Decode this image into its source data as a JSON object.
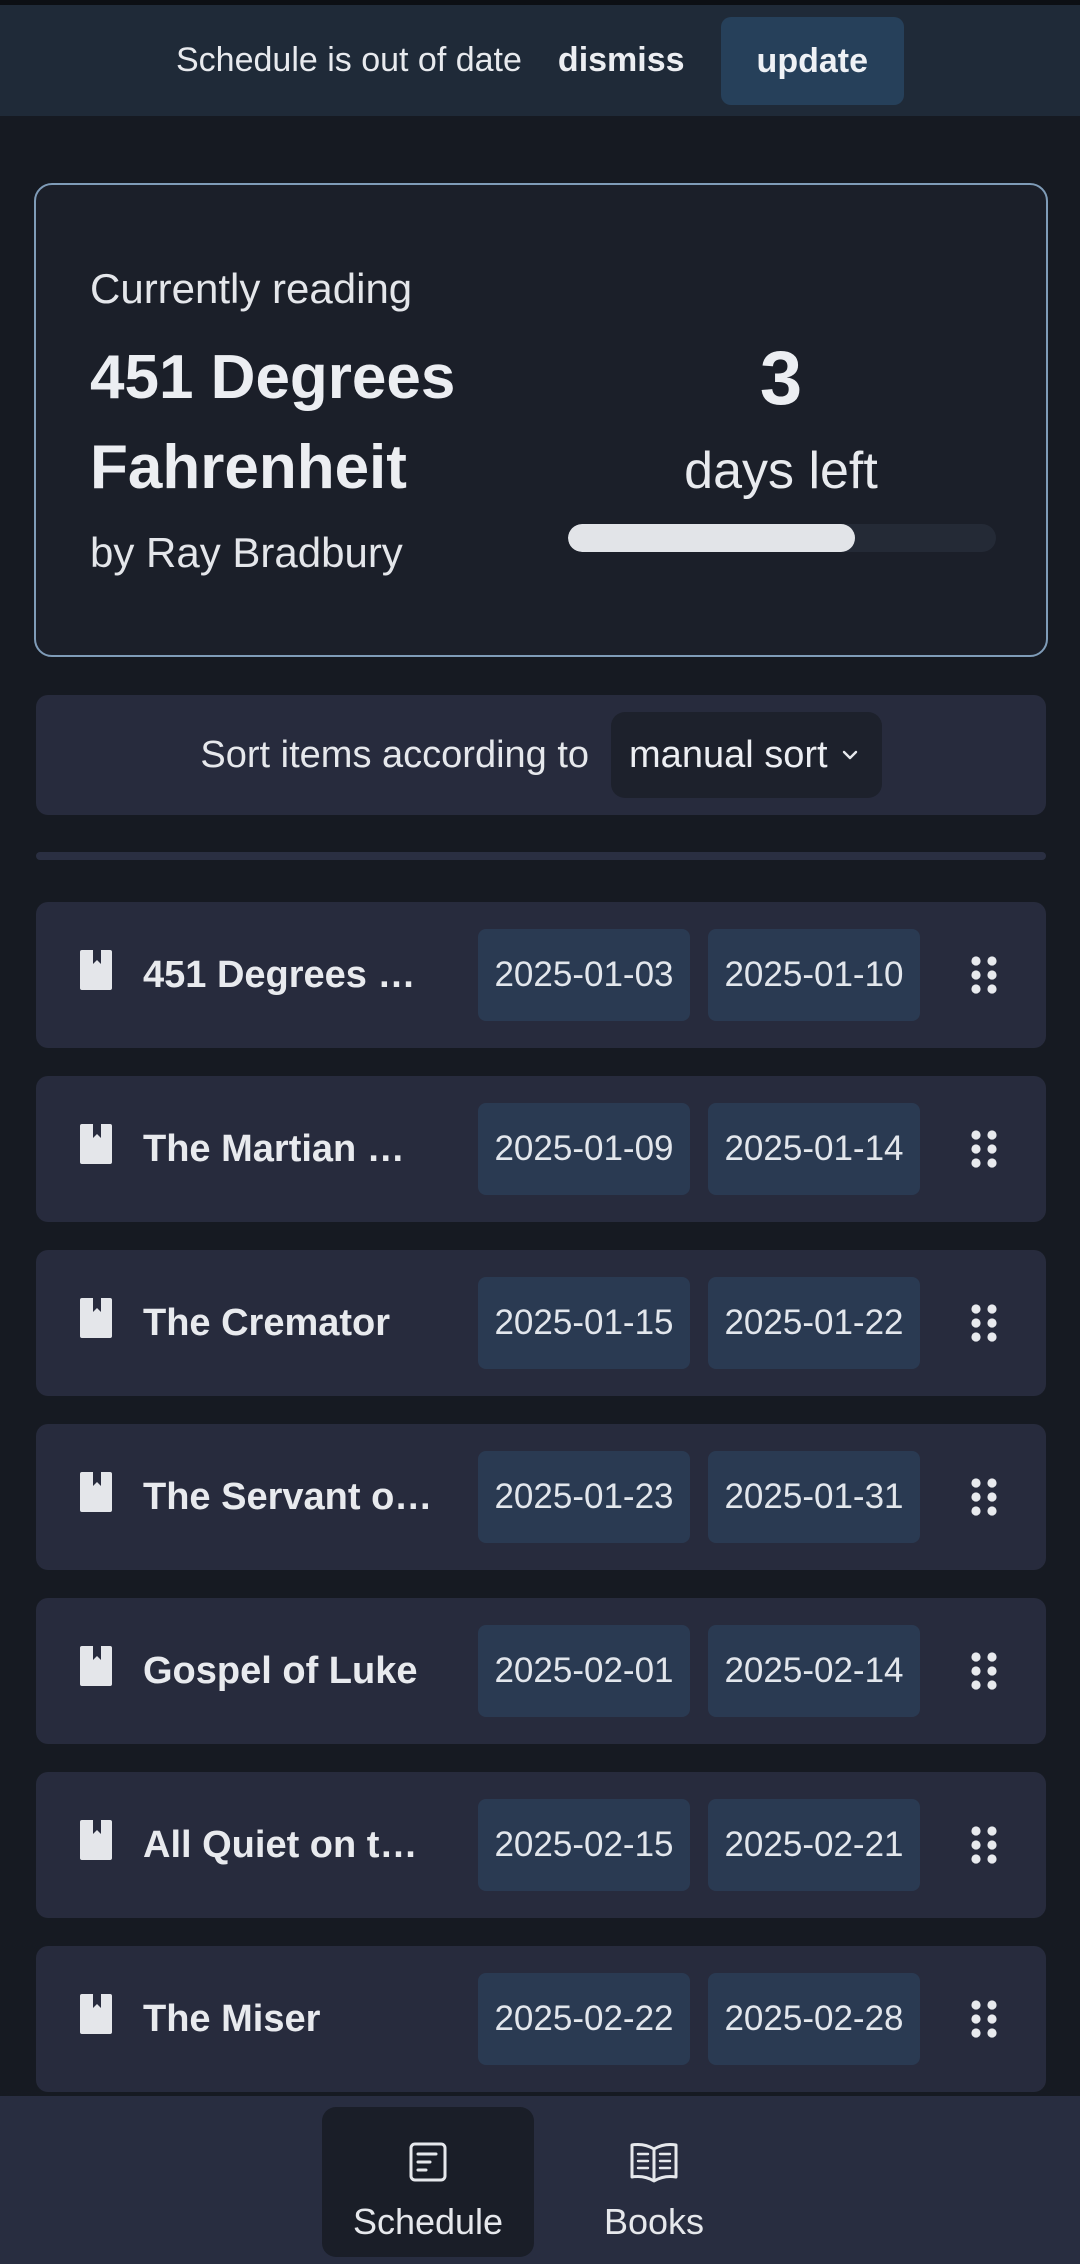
{
  "banner": {
    "message": "Schedule is out of date",
    "dismiss_label": "dismiss",
    "update_label": "update"
  },
  "current": {
    "label": "Currently reading",
    "title": "451 Degrees Fahrenheit",
    "author": "by Ray Bradbury",
    "days_left": "3",
    "days_left_label": "days left",
    "progress": 0.67
  },
  "sort": {
    "label": "Sort items according to",
    "selected": "manual sort"
  },
  "items": [
    {
      "title": "451 Degrees …",
      "start": "2025-01-03",
      "end": "2025-01-10"
    },
    {
      "title": "The Martian …",
      "start": "2025-01-09",
      "end": "2025-01-14"
    },
    {
      "title": "The Cremator",
      "start": "2025-01-15",
      "end": "2025-01-22"
    },
    {
      "title": "The Servant o…",
      "start": "2025-01-23",
      "end": "2025-01-31"
    },
    {
      "title": "Gospel of Luke",
      "start": "2025-02-01",
      "end": "2025-02-14"
    },
    {
      "title": "All Quiet on th…",
      "start": "2025-02-15",
      "end": "2025-02-21"
    },
    {
      "title": "The Miser",
      "start": "2025-02-22",
      "end": "2025-02-28"
    }
  ],
  "nav": {
    "tabs": [
      {
        "label": "Schedule",
        "icon": "schedule-icon",
        "active": true
      },
      {
        "label": "Books",
        "icon": "open-book-icon",
        "active": false
      }
    ]
  },
  "colors": {
    "background": "#161a22",
    "card": "#272b3d",
    "date_chip": "#2a3a52",
    "accent_border": "#7f9cb8"
  }
}
